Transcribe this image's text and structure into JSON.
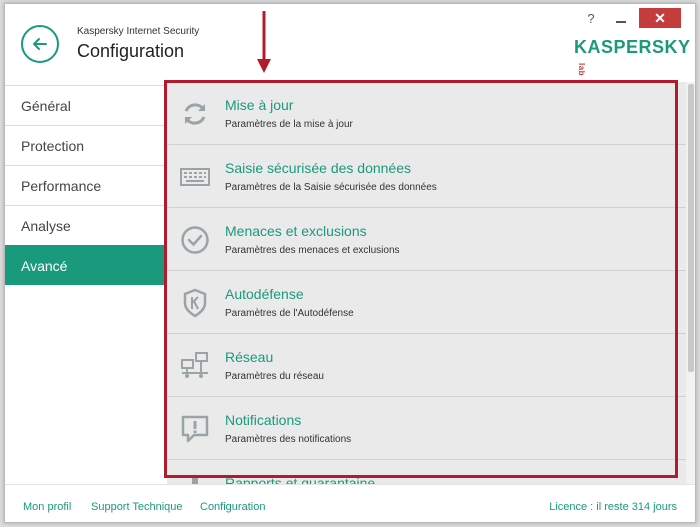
{
  "header": {
    "app_name": "Kaspersky Internet Security",
    "title": "Configuration",
    "help": "?",
    "close": "✕",
    "logo": "KASPERSKY",
    "logo_lab": "lab"
  },
  "sidebar": {
    "items": [
      {
        "label": "Général",
        "active": false
      },
      {
        "label": "Protection",
        "active": false
      },
      {
        "label": "Performance",
        "active": false
      },
      {
        "label": "Analyse",
        "active": false
      },
      {
        "label": "Avancé",
        "active": true
      }
    ]
  },
  "settings": [
    {
      "title": "Mise à jour",
      "subtitle": "Paramètres de la mise à jour",
      "icon": "refresh-icon"
    },
    {
      "title": "Saisie sécurisée des données",
      "subtitle": "Paramètres de la Saisie sécurisée des données",
      "icon": "keyboard-icon"
    },
    {
      "title": "Menaces et exclusions",
      "subtitle": "Paramètres des menaces et exclusions",
      "icon": "check-circle-icon"
    },
    {
      "title": "Autodéfense",
      "subtitle": "Paramètres de l'Autodéfense",
      "icon": "shield-icon"
    },
    {
      "title": "Réseau",
      "subtitle": "Paramètres du réseau",
      "icon": "network-icon"
    },
    {
      "title": "Notifications",
      "subtitle": "Paramètres des notifications",
      "icon": "notification-icon"
    },
    {
      "title": "Rapports et quarantaine",
      "subtitle": "",
      "icon": "reports-icon"
    }
  ],
  "footer": {
    "links": [
      "Mon profil",
      "Support Technique",
      "Configuration"
    ],
    "license": "Licence : il reste 314 jours"
  },
  "colors": {
    "accent": "#1a9a7c",
    "highlight": "#b01c2e",
    "close": "#c43c3c"
  }
}
